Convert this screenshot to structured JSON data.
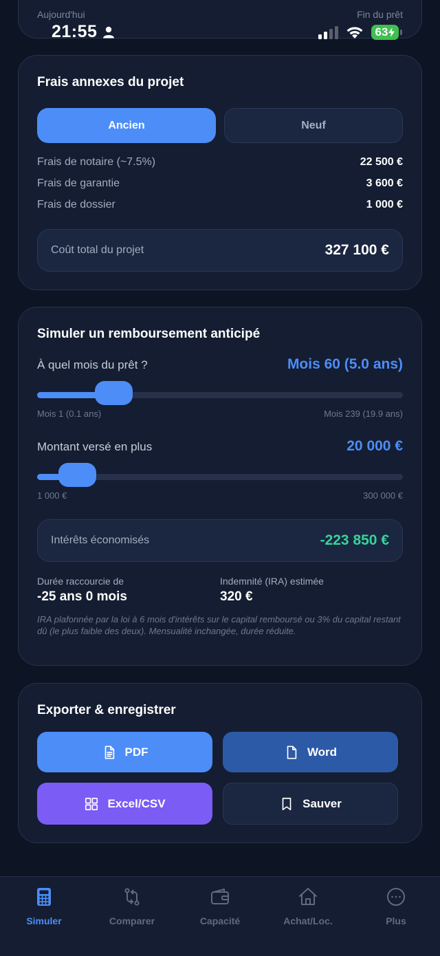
{
  "status_bar": {
    "time": "21:55",
    "battery": "63"
  },
  "top_card": {
    "left_label": "Aujourd'hui",
    "right_label": "Fin du prêt"
  },
  "frais": {
    "title": "Frais annexes du projet",
    "toggle": {
      "active": "Ancien",
      "inactive": "Neuf"
    },
    "rows": [
      {
        "label": "Frais de notaire (~7.5%)",
        "value": "22 500 €"
      },
      {
        "label": "Frais de garantie",
        "value": "3 600 €"
      },
      {
        "label": "Frais de dossier",
        "value": "1 000 €"
      }
    ],
    "total_label": "Coût total du projet",
    "total_value": "327 100 €"
  },
  "simulation": {
    "title": "Simuler un remboursement anticipé",
    "month": {
      "label": "À quel mois du prêt ?",
      "value": "Mois 60 (5.0 ans)",
      "min_label": "Mois 1 (0.1 ans)",
      "max_label": "Mois 239 (19.9 ans)",
      "position": 0.21
    },
    "amount": {
      "label": "Montant versé en plus",
      "value": "20 000 €",
      "min_label": "1 000 €",
      "max_label": "300 000 €",
      "position": 0.11
    },
    "savings_label": "Intérêts économisés",
    "savings_value": "-223 850 €",
    "duration_label": "Durée raccourcie de",
    "duration_value": "-25 ans 0 mois",
    "ira_label": "Indemnité (IRA) estimée",
    "ira_value": "320 €",
    "note": "IRA plafonnée par la loi à 6 mois d'intérêts sur le capital remboursé ou 3% du capital restant dû (le plus faible des deux). Mensualité inchangée, durée réduite."
  },
  "export": {
    "title": "Exporter & enregistrer",
    "pdf": "PDF",
    "word": "Word",
    "excel": "Excel/CSV",
    "save": "Sauver"
  },
  "tabs": [
    {
      "label": "Simuler",
      "icon": "calculator-icon",
      "active": true
    },
    {
      "label": "Comparer",
      "icon": "compare-arrows-icon",
      "active": false
    },
    {
      "label": "Capacité",
      "icon": "wallet-icon",
      "active": false
    },
    {
      "label": "Achat/Loc.",
      "icon": "home-icon",
      "active": false
    },
    {
      "label": "Plus",
      "icon": "more-icon",
      "active": false
    }
  ],
  "colors": {
    "accent": "#4d8df7",
    "success": "#36d39a",
    "violet": "#7b5cf5",
    "card": "#141d31",
    "background": "#0d1525"
  }
}
